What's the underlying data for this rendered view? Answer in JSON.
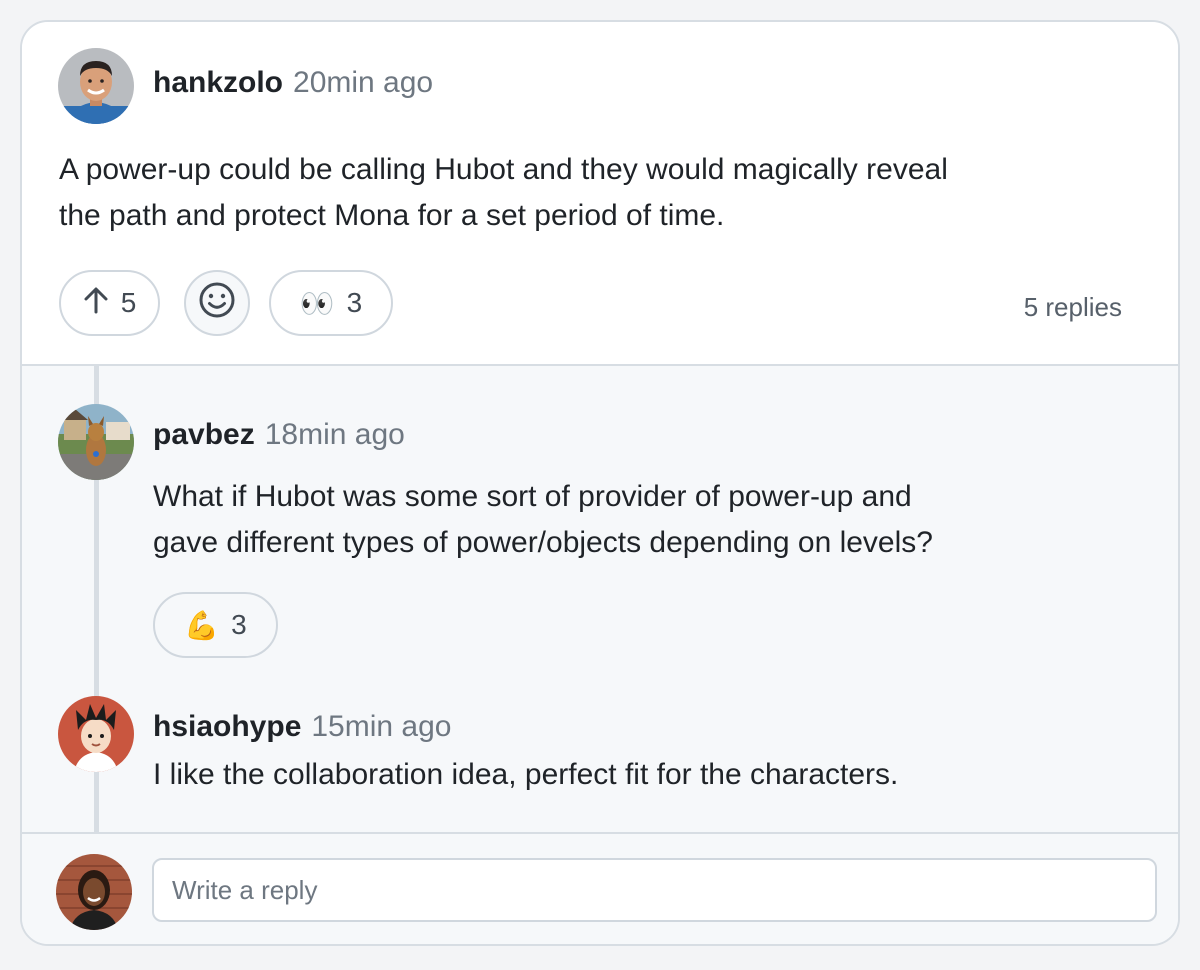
{
  "main_post": {
    "author": "hankzolo",
    "timestamp": "20min ago",
    "body_line1": "A power-up could be calling Hubot and they would magically reveal",
    "body_line2": "the path and protect Mona for a set period of time.",
    "upvote_count": "5",
    "eyes_emoji": "👀",
    "eyes_count": "3",
    "replies_label": "5 replies"
  },
  "replies": [
    {
      "author": "pavbez",
      "timestamp": "18min ago",
      "body_line1": "What if Hubot was some sort of provider of power-up and",
      "body_line2": "gave different types of power/objects depending on levels?",
      "reaction_emoji": "💪",
      "reaction_count": "3"
    },
    {
      "author": "hsiaohype",
      "timestamp": "15min ago",
      "body_line1": "I like the collaboration idea, perfect fit for the characters."
    }
  ],
  "reply_box": {
    "placeholder": "Write a reply"
  },
  "icons": {
    "upvote": "arrow-up-icon",
    "add_reaction": "smiley-icon"
  },
  "colors": {
    "card_bg": "#f6f8fa",
    "post_bg": "#ffffff",
    "border": "#d7dde3",
    "muted_text": "#6e7781"
  }
}
